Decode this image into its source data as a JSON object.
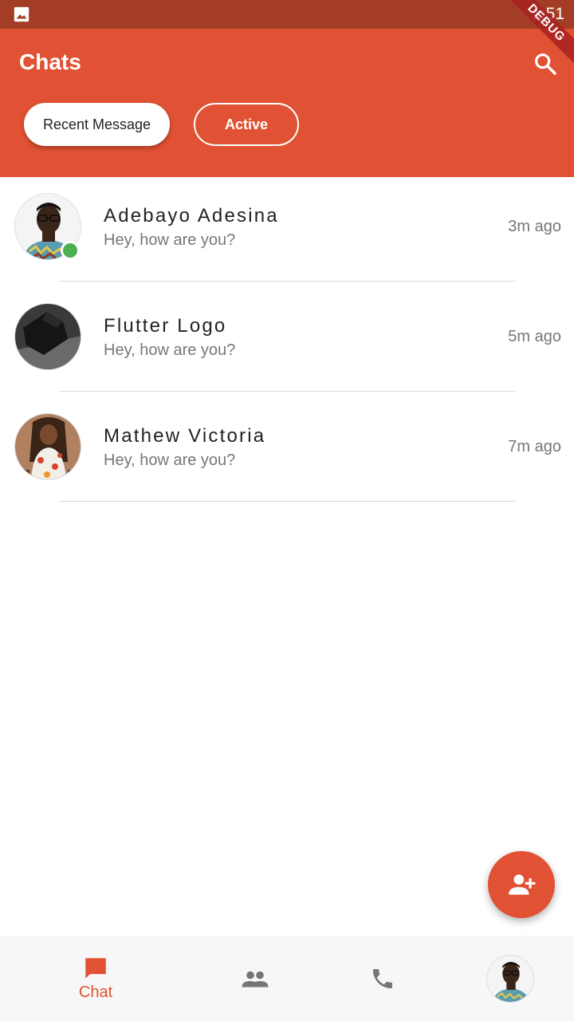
{
  "status_bar": {
    "time": "1:51",
    "icon": "image-icon"
  },
  "debug_banner": "DEBUG",
  "app_bar": {
    "title": "Chats",
    "search_icon": "search-icon",
    "filters": [
      {
        "label": "Recent Message",
        "selected": true
      },
      {
        "label": "Active",
        "selected": false
      }
    ]
  },
  "chats": [
    {
      "name": "Adebayo Adesina",
      "message": "Hey, how are you?",
      "time": "3m ago",
      "online": true
    },
    {
      "name": "Flutter Logo",
      "message": "Hey, how are you?",
      "time": "5m ago",
      "online": false
    },
    {
      "name": "Mathew Victoria",
      "message": "Hey, how are you?",
      "time": "7m ago",
      "online": false
    }
  ],
  "fab": {
    "icon": "person-add-icon"
  },
  "bottom_nav": {
    "items": [
      {
        "icon": "chat-icon",
        "label": "Chat",
        "active": true
      },
      {
        "icon": "people-icon",
        "label": "",
        "active": false
      },
      {
        "icon": "phone-icon",
        "label": "",
        "active": false
      },
      {
        "icon": "profile-avatar",
        "label": "",
        "active": false
      }
    ]
  },
  "colors": {
    "primary": "#e05233",
    "status_bar": "#a33d25",
    "online": "#4caf50",
    "inactive_icon": "#757575"
  }
}
